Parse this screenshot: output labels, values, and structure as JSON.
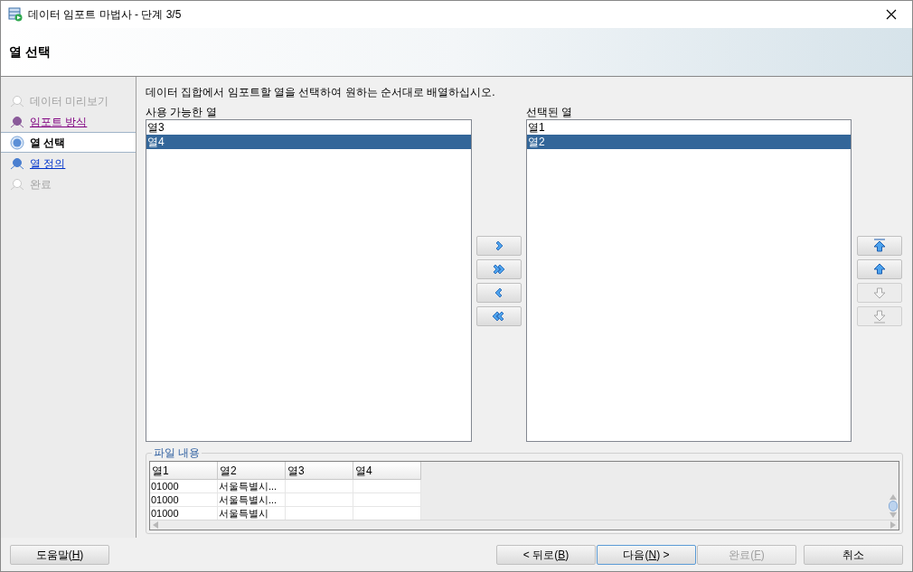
{
  "window": {
    "title": "데이터 임포트 마법사 - 단계 3/5"
  },
  "header": {
    "title": "열 선택"
  },
  "steps": [
    {
      "label": "데이터 미리보기",
      "kind": "disabled",
      "selected": false
    },
    {
      "label": "임포트 방식",
      "kind": "visited",
      "selected": false
    },
    {
      "label": "열 선택",
      "kind": "current",
      "selected": true
    },
    {
      "label": "열 정의",
      "kind": "link",
      "selected": false
    },
    {
      "label": "완료",
      "kind": "disabled",
      "selected": false
    }
  ],
  "instruction": "데이터 집합에서 임포트할 열을 선택하여 원하는 순서대로 배열하십시오.",
  "available": {
    "label": "사용 가능한 열",
    "items": [
      {
        "label": "열3",
        "selected": false
      },
      {
        "label": "열4",
        "selected": true
      }
    ]
  },
  "chosen": {
    "label": "선택된 열",
    "items": [
      {
        "label": "열1",
        "selected": false
      },
      {
        "label": "열2",
        "selected": true
      }
    ]
  },
  "move_buttons": [
    {
      "kind": "add"
    },
    {
      "kind": "add_all"
    },
    {
      "kind": "remove"
    },
    {
      "kind": "remove_all"
    }
  ],
  "order_buttons": [
    {
      "kind": "top",
      "disabled": false
    },
    {
      "kind": "up",
      "disabled": false
    },
    {
      "kind": "down",
      "disabled": true
    },
    {
      "kind": "bottom",
      "disabled": true
    }
  ],
  "file_content": {
    "title": "파일 내용",
    "columns": [
      "열1",
      "열2",
      "열3",
      "열4"
    ],
    "rows": [
      [
        "01000",
        "서울특별시..."
      ],
      [
        "01000",
        "서울특별시..."
      ],
      [
        "01000",
        "서울특별시"
      ]
    ]
  },
  "buttons": [
    {
      "before": "도움말(",
      "key": "H",
      "after": ")",
      "disabled": false,
      "default": false
    },
    {
      "before": "< 뒤로(",
      "key": "B",
      "after": ")",
      "disabled": false,
      "default": false
    },
    {
      "before": "다음(",
      "key": "N",
      "after": ") >",
      "disabled": false,
      "default": true
    },
    {
      "before": "완료(",
      "key": "F",
      "after": ")",
      "disabled": true,
      "default": false
    },
    {
      "before": "취소",
      "disabled": false,
      "default": false
    }
  ]
}
